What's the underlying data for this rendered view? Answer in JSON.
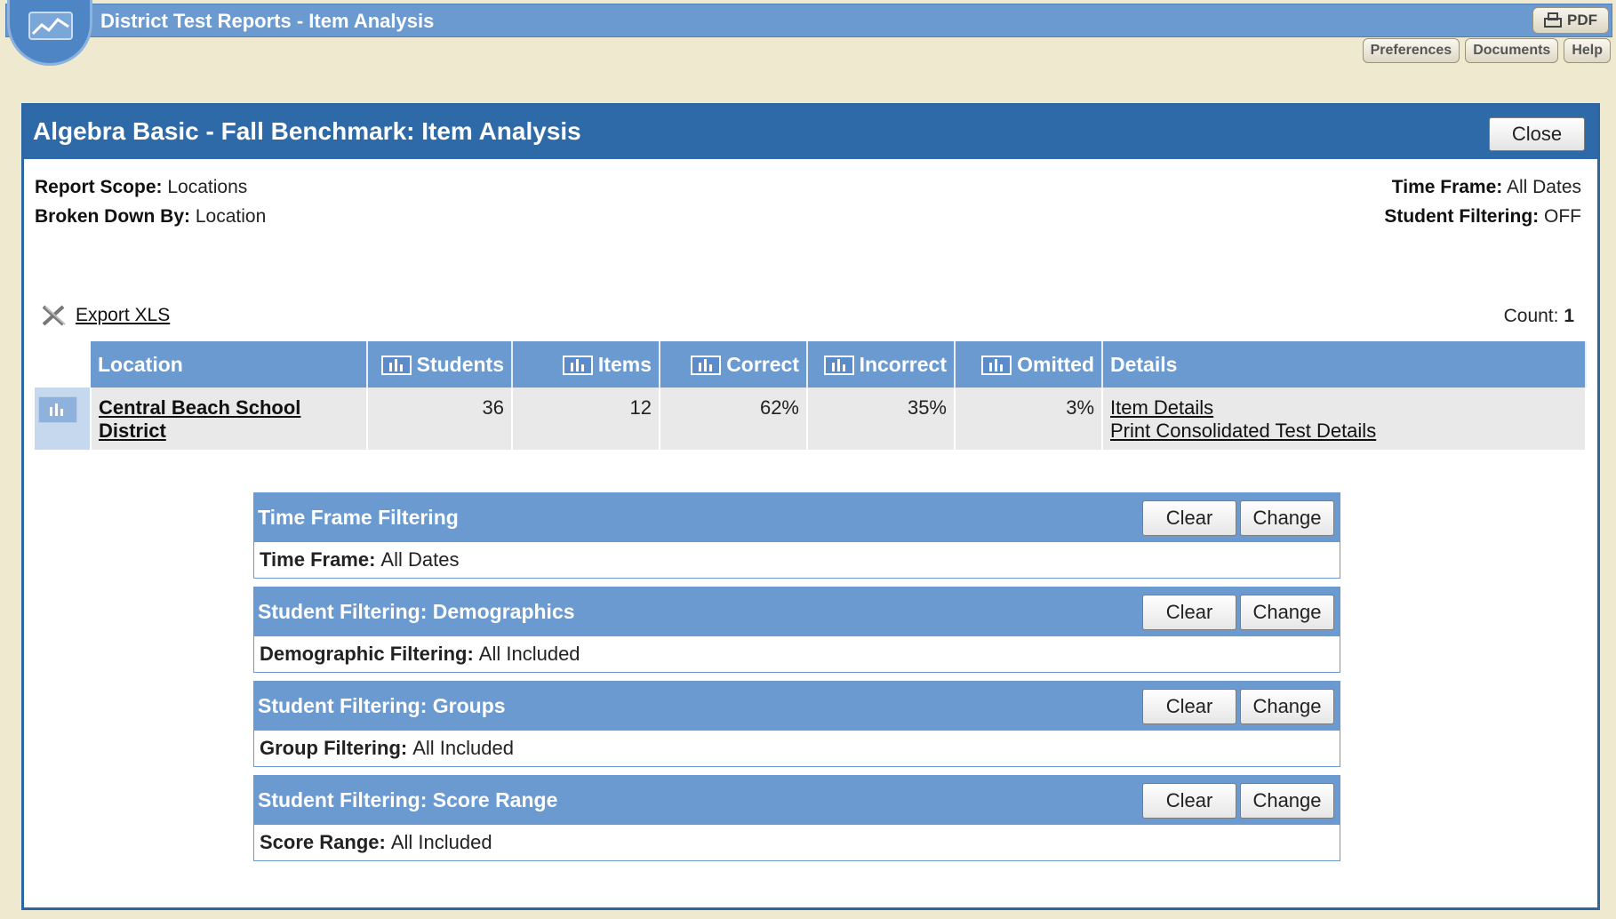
{
  "app": {
    "title": "District Test Reports - Item Analysis",
    "pdf_label": "PDF",
    "utility_links": [
      "Preferences",
      "Documents",
      "Help"
    ]
  },
  "report": {
    "title": "Algebra Basic - Fall Benchmark: Item Analysis",
    "close_label": "Close",
    "scope_label": "Report Scope:",
    "scope_value": "Locations",
    "breakdown_label": "Broken Down By:",
    "breakdown_value": "Location",
    "timeframe_label": "Time Frame:",
    "timeframe_value": "All Dates",
    "student_filter_label": "Student Filtering:",
    "student_filter_value": "OFF",
    "export_label": "Export XLS",
    "count_label": "Count:",
    "count_value": "1"
  },
  "table": {
    "columns": [
      "Location",
      "Students",
      "Items",
      "Correct",
      "Incorrect",
      "Omitted",
      "Details"
    ],
    "rows": [
      {
        "location": "Central Beach School District",
        "students": "36",
        "items": "12",
        "correct": "62%",
        "incorrect": "35%",
        "omitted": "3%",
        "detail_links": [
          "Item Details",
          "Print Consolidated Test Details"
        ]
      }
    ]
  },
  "filters": [
    {
      "title": "Time Frame Filtering",
      "label": "Time Frame:",
      "value": "All Dates",
      "clear": "Clear",
      "change": "Change"
    },
    {
      "title": "Student Filtering: Demographics",
      "label": "Demographic Filtering:",
      "value": "All Included",
      "clear": "Clear",
      "change": "Change"
    },
    {
      "title": "Student Filtering: Groups",
      "label": "Group Filtering:",
      "value": "All Included",
      "clear": "Clear",
      "change": "Change"
    },
    {
      "title": "Student Filtering: Score Range",
      "label": "Score Range:",
      "value": "All Included",
      "clear": "Clear",
      "change": "Change"
    }
  ],
  "colors": {
    "header_blue": "#2f6aa8",
    "column_blue": "#6b9ad1",
    "page_background": "#efe9cf"
  }
}
